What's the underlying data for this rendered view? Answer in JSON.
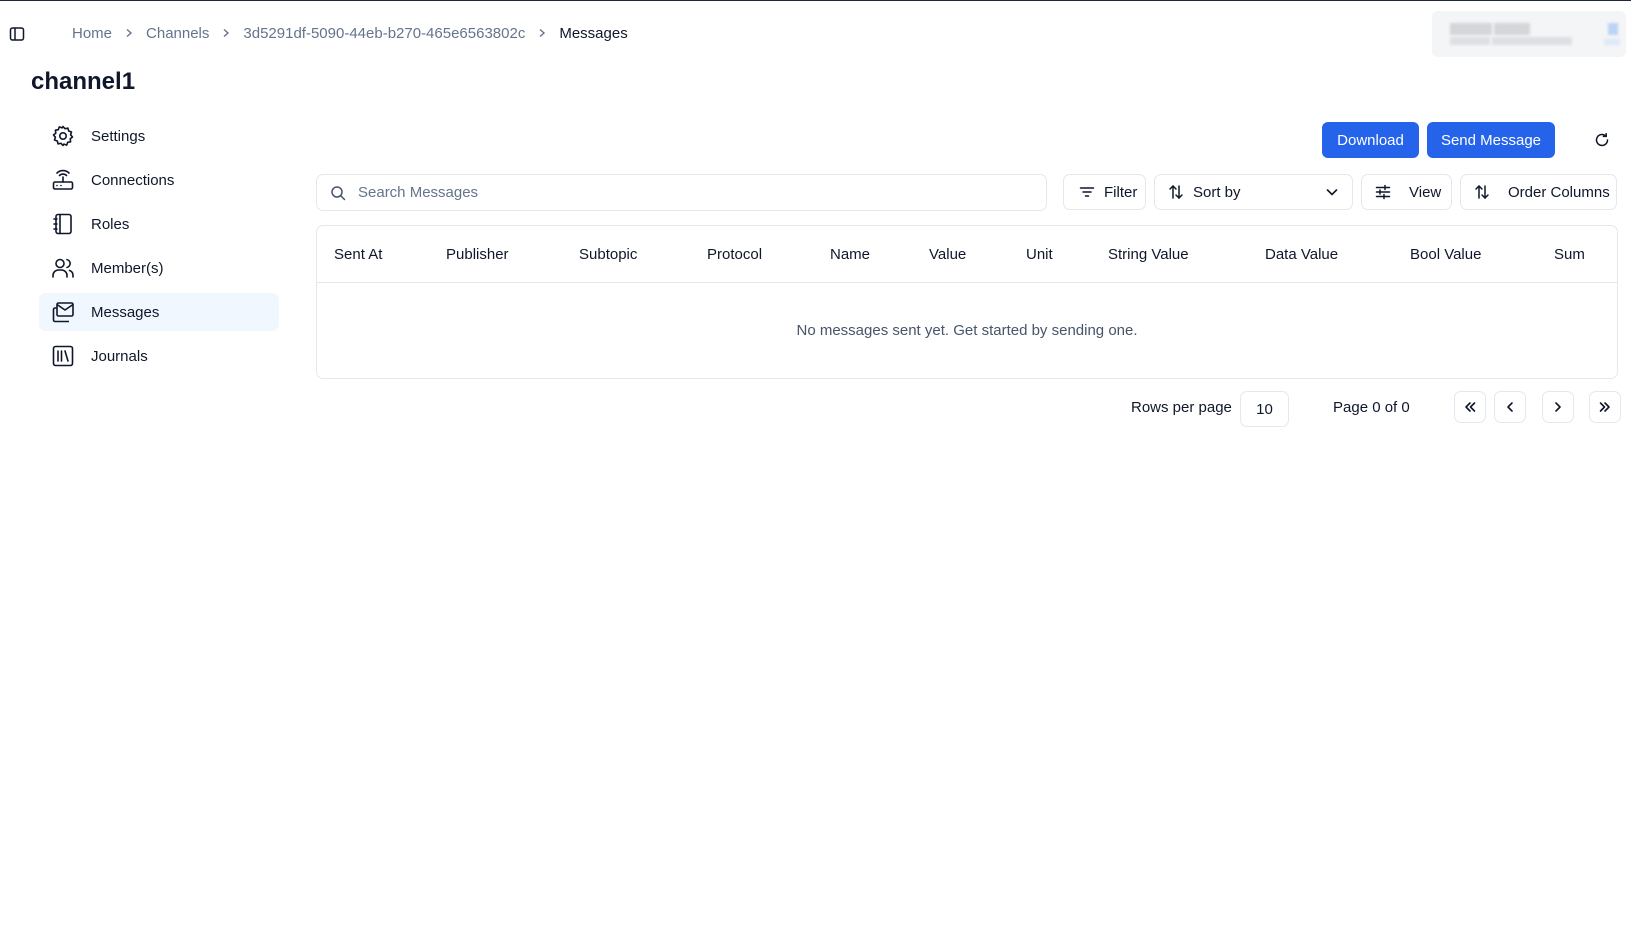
{
  "breadcrumb": {
    "items": [
      "Home",
      "Channels",
      "3d5291df-5090-44eb-b270-465e6563802c",
      "Messages"
    ]
  },
  "page": {
    "title": "channel1"
  },
  "sidebar": {
    "items": [
      {
        "label": "Settings",
        "icon": "settings-gear-icon"
      },
      {
        "label": "Connections",
        "icon": "router-icon"
      },
      {
        "label": "Roles",
        "icon": "notebook-icon"
      },
      {
        "label": "Member(s)",
        "icon": "users-icon"
      },
      {
        "label": "Messages",
        "icon": "mail-stack-icon",
        "active": true
      },
      {
        "label": "Journals",
        "icon": "library-icon"
      }
    ]
  },
  "actions": {
    "download_label": "Download",
    "send_message_label": "Send Message"
  },
  "toolbar": {
    "search_placeholder": "Search Messages",
    "search_value": "",
    "filter_label": "Filter",
    "sort_label": "Sort by",
    "view_label": "View",
    "order_columns_label": "Order Columns"
  },
  "table": {
    "columns": [
      "Sent At",
      "Publisher",
      "Subtopic",
      "Protocol",
      "Name",
      "Value",
      "Unit",
      "String Value",
      "Data Value",
      "Bool Value",
      "Sum"
    ],
    "empty_message": "No messages sent yet. Get started by sending one."
  },
  "pagination": {
    "rows_per_page_label": "Rows per page",
    "rows_per_page_value": "10",
    "page_info": "Page 0 of 0"
  },
  "colors": {
    "primary": "#2563eb",
    "active_nav_bg": "#f1f7fe",
    "border": "#e2e8f0",
    "muted_text": "#64748b"
  }
}
